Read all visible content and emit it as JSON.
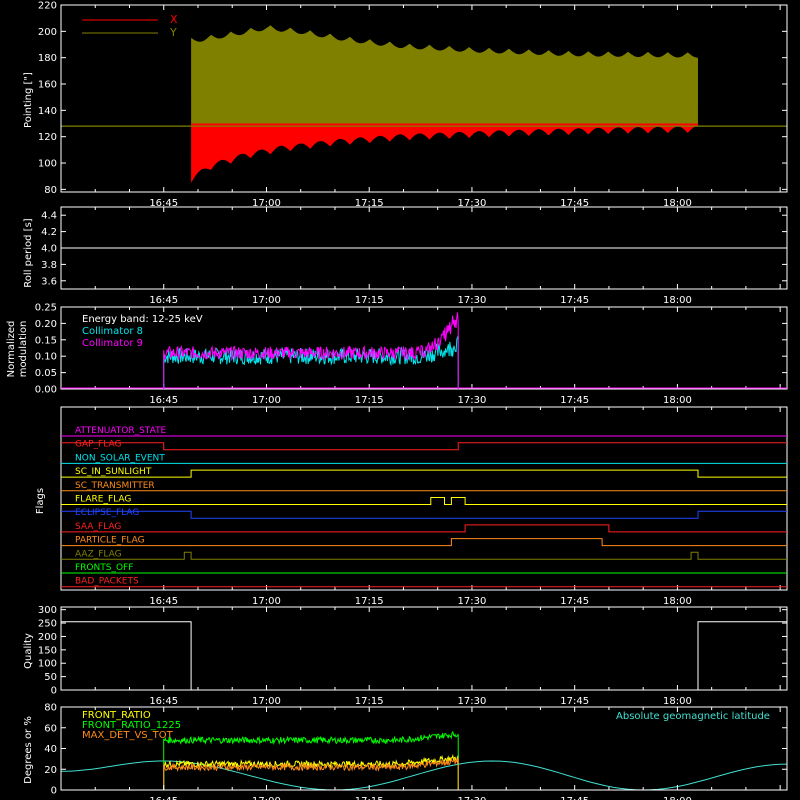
{
  "colors": {
    "background": "#000000",
    "axis": "#ffffff",
    "x_pointing": "#ff0000",
    "y_pointing": "#808000",
    "collimator8": "#00e5ee",
    "collimator9": "#ff00ff",
    "front_ratio": "#ffff00",
    "front_ratio_1225": "#00ff00",
    "max_det_vs_tot": "#ff8c1a",
    "geomag": "#40e0d0"
  },
  "chart_data": [
    {
      "id": "pointing",
      "type": "area",
      "title": "",
      "xlabel": "",
      "ylabel": "Pointing [\"]",
      "ylim": [
        78,
        220
      ],
      "yticks": [
        80,
        100,
        120,
        140,
        160,
        180,
        200,
        220
      ],
      "x_range": [
        "16:30",
        "18:16"
      ],
      "xtick_labels": [
        "16:45",
        "17:00",
        "17:15",
        "17:30",
        "17:45",
        "18:00"
      ],
      "baseline": 128,
      "legend": {
        "position": "top-left",
        "entries": [
          {
            "label": "X",
            "color": "#ff0000"
          },
          {
            "label": "Y",
            "color": "#808000"
          }
        ]
      },
      "series": [
        {
          "name": "X",
          "color": "#ff0000",
          "start": "16:49",
          "end": "18:03",
          "baseline": 128,
          "lower_envelope": [
            [
              "16:49",
              85
            ],
            [
              "16:52",
              95
            ],
            [
              "16:57",
              103
            ],
            [
              "17:02",
              108
            ],
            [
              "17:10",
              113
            ],
            [
              "17:20",
              117
            ],
            [
              "17:35",
              120
            ],
            [
              "17:50",
              122
            ],
            [
              "18:03",
              123
            ]
          ],
          "upper_envelope": [
            [
              "16:49",
              128
            ],
            [
              "17:30",
              130
            ],
            [
              "18:03",
              131
            ]
          ]
        },
        {
          "name": "Y",
          "color": "#808000",
          "start": "16:49",
          "end": "18:03",
          "baseline": 128,
          "lower_envelope": [
            [
              "16:49",
              128
            ],
            [
              "18:03",
              128
            ]
          ],
          "upper_envelope": [
            [
              "16:49",
              195
            ],
            [
              "16:55",
              200
            ],
            [
              "17:00",
              205
            ],
            [
              "17:05",
              202
            ],
            [
              "17:12",
              196
            ],
            [
              "17:20",
              191
            ],
            [
              "17:30",
              188
            ],
            [
              "17:45",
              185
            ],
            [
              "18:03",
              184
            ]
          ]
        }
      ]
    },
    {
      "id": "roll",
      "type": "line",
      "ylabel": "Roll period [s]",
      "ylim": [
        3.5,
        4.5
      ],
      "yticks": [
        3.6,
        3.8,
        4.0,
        4.2,
        4.4
      ],
      "x_range": [
        "16:30",
        "18:16"
      ],
      "xtick_labels": [
        "16:45",
        "17:00",
        "17:15",
        "17:30",
        "17:45",
        "18:00"
      ],
      "series": [
        {
          "color": "#ffffff",
          "x": [
            "16:30",
            "18:16"
          ],
          "y": [
            4.0,
            4.0
          ]
        }
      ]
    },
    {
      "id": "modulation",
      "type": "line",
      "ylabel": "Normalized modulation",
      "ylim": [
        0,
        0.25
      ],
      "yticks": [
        0.0,
        0.05,
        0.1,
        0.15,
        0.2,
        0.25
      ],
      "x_range": [
        "16:30",
        "18:16"
      ],
      "xtick_labels": [
        "16:45",
        "17:00",
        "17:15",
        "17:30",
        "17:45",
        "18:00"
      ],
      "annotation": "Energy band: 12-25 keV",
      "legend": {
        "position": "top-left",
        "entries": [
          {
            "label": "Collimator 8",
            "color": "#00e5ee"
          },
          {
            "label": "Collimator 9",
            "color": "#ff00ff"
          }
        ]
      },
      "series": [
        {
          "name": "Collimator 8",
          "color": "#00e5ee",
          "start": "16:45",
          "end": "17:28",
          "level": 0.1,
          "spread": 0.025,
          "end_level": 0.15
        },
        {
          "name": "Collimator 9",
          "color": "#ff00ff",
          "start": "16:45",
          "end": "17:28",
          "level": 0.11,
          "spread": 0.02,
          "end_level": 0.25
        }
      ]
    },
    {
      "id": "flags",
      "type": "line",
      "ylabel": "Flags",
      "x_range": [
        "16:30",
        "18:16"
      ],
      "xtick_labels": [
        "16:45",
        "17:00",
        "17:15",
        "17:30",
        "17:45",
        "18:00"
      ],
      "series": [
        {
          "name": "ATTENUATOR_STATE",
          "color": "#ff00ff",
          "high": []
        },
        {
          "name": "GAP_FLAG",
          "color": "#ff2020",
          "high": [
            [
              "16:30",
              "16:45"
            ],
            [
              "17:28",
              "18:16"
            ]
          ]
        },
        {
          "name": "NON_SOLAR_EVENT",
          "color": "#00e5ee",
          "high": []
        },
        {
          "name": "SC_IN_SUNLIGHT",
          "color": "#ffff00",
          "high": [
            [
              "16:49",
              "18:03"
            ]
          ]
        },
        {
          "name": "SC_TRANSMITTER",
          "color": "#ff8c1a",
          "high": []
        },
        {
          "name": "FLARE_FLAG",
          "color": "#ffff00",
          "high": [
            [
              "17:24",
              "17:26"
            ],
            [
              "17:27",
              "17:29"
            ]
          ]
        },
        {
          "name": "ECLIPSE_FLAG",
          "color": "#2244ff",
          "high": [
            [
              "16:30",
              "16:49"
            ],
            [
              "18:03",
              "18:16"
            ]
          ]
        },
        {
          "name": "SAA_FLAG",
          "color": "#ff2020",
          "high": [
            [
              "17:29",
              "17:50"
            ]
          ]
        },
        {
          "name": "PARTICLE_FLAG",
          "color": "#ff8c1a",
          "high": [
            [
              "17:27",
              "17:49"
            ]
          ]
        },
        {
          "name": "AAZ_FLAG",
          "color": "#808000",
          "high": [
            [
              "16:48",
              "16:49"
            ],
            [
              "18:02",
              "18:03"
            ]
          ]
        },
        {
          "name": "FRONTS_OFF",
          "color": "#00ff00",
          "high": []
        },
        {
          "name": "BAD_PACKETS",
          "color": "#ff2020",
          "high": []
        }
      ]
    },
    {
      "id": "quality",
      "type": "line",
      "ylabel": "Quality",
      "ylim": [
        0,
        310
      ],
      "yticks": [
        0,
        50,
        100,
        150,
        200,
        250,
        300
      ],
      "x_range": [
        "16:30",
        "18:16"
      ],
      "xtick_labels": [
        "16:45",
        "17:00",
        "17:15",
        "17:30",
        "17:45",
        "18:00"
      ],
      "series": [
        {
          "color": "#ffffff",
          "x": [
            "16:30",
            "16:49",
            "16:49",
            "18:03",
            "18:03",
            "18:16"
          ],
          "y": [
            255,
            255,
            0,
            0,
            255,
            255
          ]
        }
      ]
    },
    {
      "id": "ratios",
      "type": "line",
      "ylabel": "Degrees or %",
      "ylim": [
        0,
        80
      ],
      "yticks": [
        0,
        20,
        40,
        60,
        80
      ],
      "x_range": [
        "16:30",
        "18:16"
      ],
      "xtick_labels": [
        "16:45",
        "17:00",
        "17:15",
        "17:30",
        "17:45",
        "18:00"
      ],
      "legend": {
        "position": "top-left",
        "entries": [
          {
            "label": "FRONT_RATIO",
            "color": "#ffff00"
          },
          {
            "label": "FRONT_RATIO_1225",
            "color": "#00ff00"
          },
          {
            "label": "MAX_DET_VS_TOT",
            "color": "#ff8c1a"
          }
        ]
      },
      "annotation": "Absolute geomagnetic latitude",
      "series": [
        {
          "name": "FRONT_RATIO",
          "color": "#ffff00",
          "start": "16:45",
          "end": "17:28",
          "level": 25,
          "spread": 3
        },
        {
          "name": "FRONT_RATIO_1225",
          "color": "#00ff00",
          "start": "16:45",
          "end": "17:28",
          "level": 48,
          "spread": 3
        },
        {
          "name": "MAX_DET_VS_TOT",
          "color": "#ff8c1a",
          "start": "16:45",
          "end": "17:28",
          "level": 22,
          "spread": 3
        },
        {
          "name": "Absolute geomagnetic latitude",
          "color": "#40e0d0",
          "x": [
            "16:30",
            "16:45",
            "17:10",
            "17:33",
            "17:55",
            "18:16"
          ],
          "y": [
            18,
            28,
            0,
            28,
            0,
            25
          ]
        }
      ]
    }
  ]
}
